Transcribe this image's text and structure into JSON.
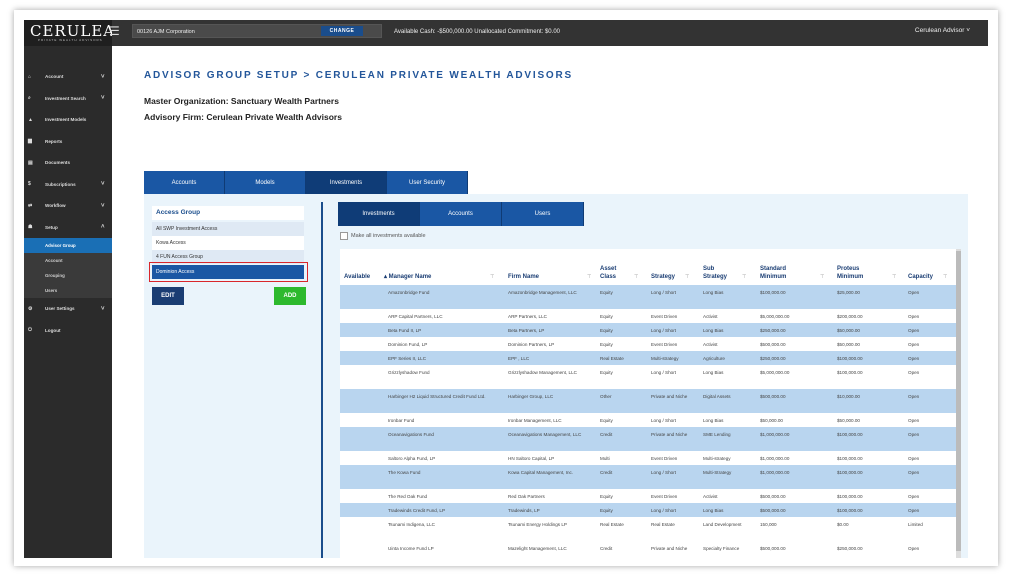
{
  "brand": {
    "name": "CERULEAN",
    "sub": "PRIVATE WEALTH ADVISORS"
  },
  "topbar": {
    "org": "00126 AJM Corporation",
    "change": "CHANGE",
    "cash": "Available Cash: -$500,000.00   Unallocated Commitment: $0.00",
    "advisor": "Cerulean Advisor ˅"
  },
  "sidebar": {
    "items": [
      {
        "icon": "⌂",
        "label": "Account",
        "chev": "˅"
      },
      {
        "icon": "⌕",
        "label": "Investment Search",
        "chev": "˅"
      },
      {
        "icon": "▲",
        "label": "Investment Models",
        "chev": ""
      },
      {
        "icon": "▆",
        "label": "Reports",
        "chev": ""
      },
      {
        "icon": "▤",
        "label": "Documents",
        "chev": ""
      },
      {
        "icon": "$",
        "label": "Subscriptions",
        "chev": "˅"
      },
      {
        "icon": "⇄",
        "label": "Workflow",
        "chev": "˅"
      },
      {
        "icon": "☗",
        "label": "Setup",
        "chev": "˄"
      }
    ],
    "sub_items": [
      "Advisor Group",
      "Account",
      "Grouping",
      "Users"
    ],
    "bottom_items": [
      {
        "icon": "⚙",
        "label": "User Settings",
        "chev": "˅"
      },
      {
        "icon": "⏻",
        "label": "Logout",
        "chev": ""
      }
    ]
  },
  "page": {
    "title": "ADVISOR GROUP SETUP > CERULEAN PRIVATE WEALTH ADVISORS",
    "master_org": "Master Organization: Sanctuary Wealth Partners",
    "advisory_firm": "Advisory Firm: Cerulean Private Wealth Advisors"
  },
  "tabs": [
    "Accounts",
    "Models",
    "Investments",
    "User Security"
  ],
  "access_group": {
    "header": "Access Group",
    "items": [
      "All SWP Investment Access",
      "Kowa Access",
      "4 FUN Access Group",
      "Dominion Access"
    ],
    "edit": "EDIT",
    "add": "ADD"
  },
  "subtabs": [
    "Investments",
    "Accounts",
    "Users"
  ],
  "make_all": "Make all investments available",
  "table": {
    "headers": {
      "available": "Available",
      "manager": "▴ Manager Name",
      "firm": "Firm Name",
      "asset": "Asset Class",
      "strategy": "Strategy",
      "sub": "Sub Strategy",
      "std": "Standard Minimum",
      "proteus": "Proteus Minimum",
      "capacity": "Capacity"
    },
    "filter_icon": "⊤",
    "rows": [
      {
        "manager": "Amazonbridge Fund",
        "firm": "Amazonbridge Management, LLC",
        "asset": "Equity",
        "strategy": "Long / Short",
        "sub": "Long Bias",
        "std": "$100,000.00",
        "proteus": "$25,000.00",
        "capacity": "Open"
      },
      {
        "manager": "ARP Capital Partners, LLC",
        "firm": "ARP Partners, LLC",
        "asset": "Equity",
        "strategy": "Event Driven",
        "sub": "Activist",
        "std": "$5,000,000.00",
        "proteus": "$200,000.00",
        "capacity": "Open"
      },
      {
        "manager": "Beta Fund II, LP",
        "firm": "Beta Partners, LP",
        "asset": "Equity",
        "strategy": "Long / Short",
        "sub": "Long Bias",
        "std": "$250,000.00",
        "proteus": "$50,000.00",
        "capacity": "Open"
      },
      {
        "manager": "Dominion Fund, LP",
        "firm": "Dominion Partners, LP",
        "asset": "Equity",
        "strategy": "Event Driven",
        "sub": "Activist",
        "std": "$500,000.00",
        "proteus": "$50,000.00",
        "capacity": "Open"
      },
      {
        "manager": "EPF Series II, LLC",
        "firm": "EPF , LLC",
        "asset": "Real Estate",
        "strategy": "Multi-strategy",
        "sub": "Agriculture",
        "std": "$250,000.00",
        "proteus": "$100,000.00",
        "capacity": "Open"
      },
      {
        "manager": "Grizzlyshadow Fund",
        "firm": "Grizzlyshadow Management, LLC",
        "asset": "Equity",
        "strategy": "Long / Short",
        "sub": "Long Bias",
        "std": "$5,000,000.00",
        "proteus": "$100,000.00",
        "capacity": "Open"
      },
      {
        "manager": "Harbinger H2 Liquid Structured Credit Fund Ltd.",
        "firm": "Harbinger Group, LLC",
        "asset": "Other",
        "strategy": "Private and Niche",
        "sub": "Digital Assets",
        "std": "$500,000.00",
        "proteus": "$10,000.00",
        "capacity": "Open"
      },
      {
        "manager": "Ironbar Fund",
        "firm": "Ironbar Management, LLC",
        "asset": "Equity",
        "strategy": "Long / Short",
        "sub": "Long Bias",
        "std": "$50,000.00",
        "proteus": "$50,000.00",
        "capacity": "Open"
      },
      {
        "manager": "Oceanavigations Fund",
        "firm": "Oceanavigations Management, LLC",
        "asset": "Credit",
        "strategy": "Private and Niche",
        "sub": "SME Lending",
        "std": "$1,000,000.00",
        "proteus": "$100,000.00",
        "capacity": "Open"
      },
      {
        "manager": "Saltoro Alpha Fund, LP",
        "firm": "HN Saltoro Capital, LP",
        "asset": "Multi",
        "strategy": "Event Driven",
        "sub": "Multi-strategy",
        "std": "$1,000,000.00",
        "proteus": "$100,000.00",
        "capacity": "Open"
      },
      {
        "manager": "The Kowa Fund",
        "firm": "Kowa Capital Management, Inc.",
        "asset": "Credit",
        "strategy": "Long / Short",
        "sub": "Multi-Strategy",
        "std": "$1,000,000.00",
        "proteus": "$100,000.00",
        "capacity": "Open"
      },
      {
        "manager": "The Red Oak Fund",
        "firm": "Red Oak Partners",
        "asset": "Equity",
        "strategy": "Event Driven",
        "sub": "Activist",
        "std": "$500,000.00",
        "proteus": "$100,000.00",
        "capacity": "Open"
      },
      {
        "manager": "Tradewinds Credit Fund, LP",
        "firm": "Tradewinds, LP",
        "asset": "Equity",
        "strategy": "Long / Short",
        "sub": "Long Bias",
        "std": "$500,000.00",
        "proteus": "$100,000.00",
        "capacity": "Open"
      },
      {
        "manager": "Tsunami Indigena, LLC",
        "firm": "Tsunami Energy Holdings LP",
        "asset": "Real Estate",
        "strategy": "Real Estate",
        "sub": "Land Development",
        "std": "150,000",
        "proteus": "$0.00",
        "capacity": "Limited"
      },
      {
        "manager": "Uinta Income Fund LP",
        "firm": "Mazelight Management, LLC",
        "asset": "Credit",
        "strategy": "Private and Niche",
        "sub": "Specialty Finance",
        "std": "$500,000.00",
        "proteus": "$250,000.00",
        "capacity": "Open"
      }
    ]
  },
  "colors": {
    "accent": "#1a57a4",
    "highlight": "#d9262b",
    "add": "#2db92d"
  }
}
